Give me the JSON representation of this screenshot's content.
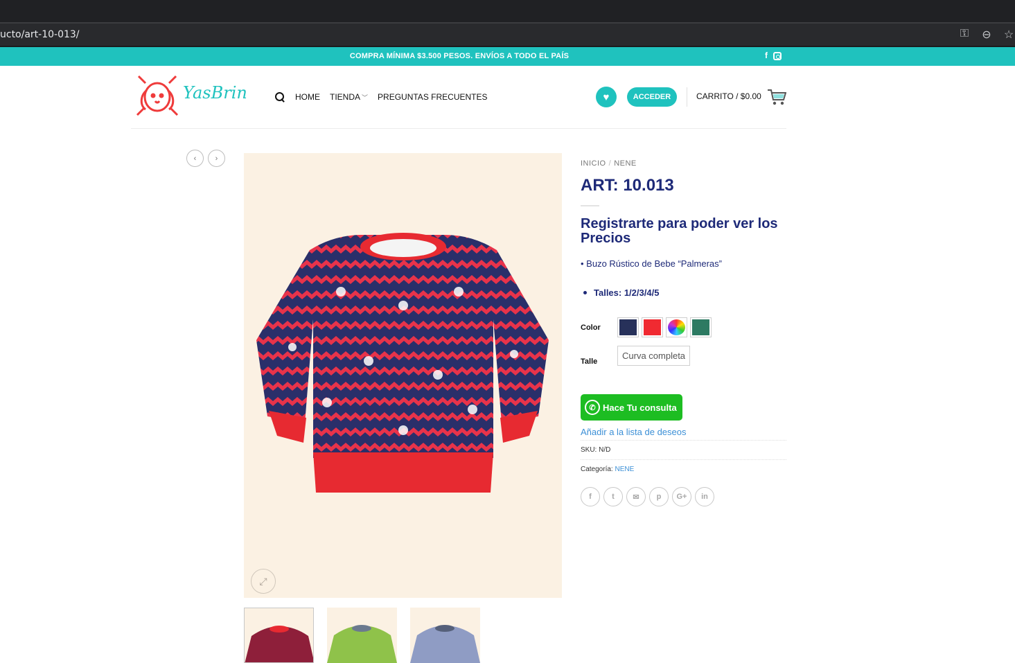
{
  "browser": {
    "url": "ucto/art-10-013/",
    "icons": [
      "key-icon",
      "zoom-icon",
      "star-icon"
    ]
  },
  "topbar": {
    "message": "COMPRA MÍNIMA $3.500 PESOS. ENVÍOS A TODO EL PAÍS",
    "social": [
      "facebook-icon",
      "instagram-icon"
    ],
    "background": "#1fc2be"
  },
  "header": {
    "logo_text": "YasBrin",
    "nav": [
      {
        "label": "HOME"
      },
      {
        "label": "TIENDA"
      },
      {
        "label": "PREGUNTAS FRECUENTES"
      }
    ],
    "login_label": "ACCEDER",
    "cart_label": "CARRITO / $0.00"
  },
  "product": {
    "breadcrumb": [
      "INICIO",
      "NENE"
    ],
    "title": "ART: 10.013",
    "price_notice": "Registrarte para poder ver los Precios",
    "description": "• Buzo Rústico de Bebe “Palmeras”",
    "talles": "Talles: 1/2/3/4/5",
    "color_label": "Color",
    "colors": [
      "#27315a",
      "#f02a31",
      "multicolor",
      "#2d7a62"
    ],
    "size_label": "Talle",
    "size_option": "Curva completa",
    "whatsapp_label": "Hace Tu consulta",
    "wishlist_label": "Añadir a la lista de deseos",
    "sku_label": "SKU:",
    "sku_value": "N/D",
    "category_label": "Categoría:",
    "category_value": "NENE",
    "share": [
      "f",
      "t",
      "✉",
      "p",
      "G+",
      "in"
    ]
  },
  "colors": {
    "accent": "#1fc2be",
    "heading": "#1e2a78",
    "whatsapp": "#1dbd22",
    "link": "#3b8fd6"
  }
}
